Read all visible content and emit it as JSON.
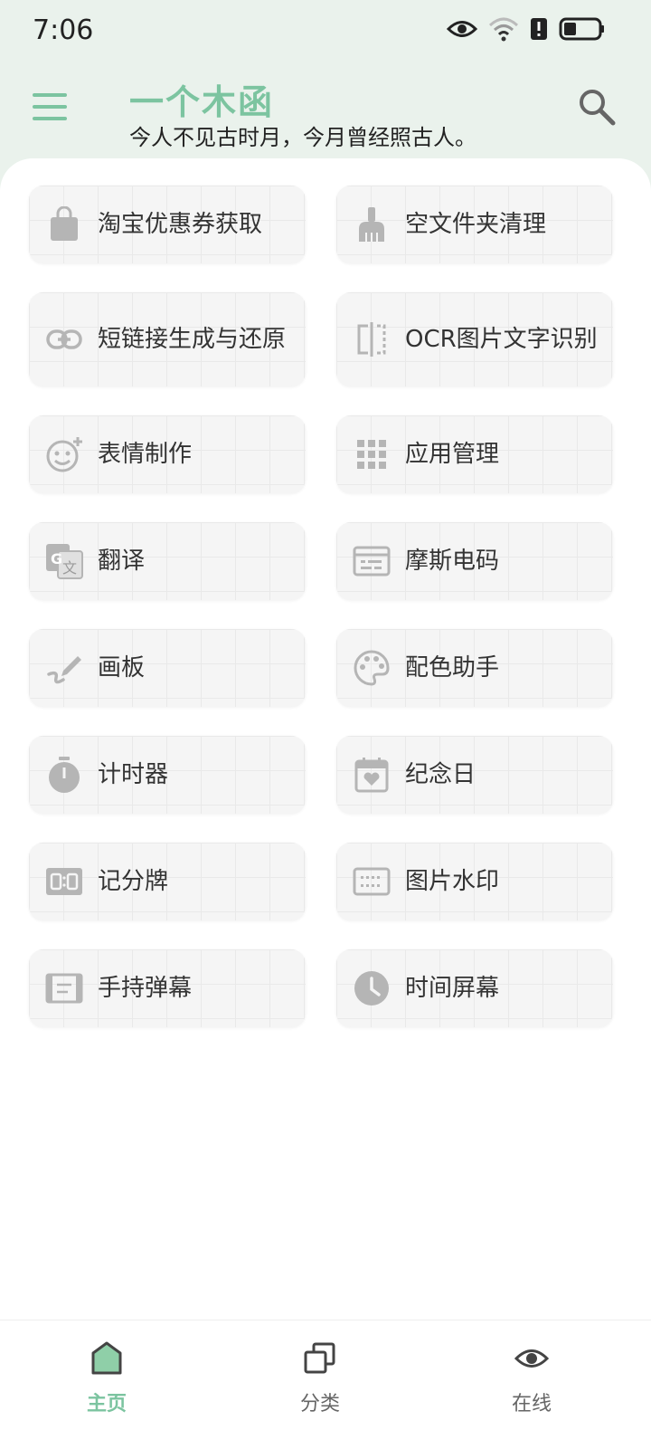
{
  "status_bar": {
    "time": "7:06",
    "icons": [
      "eye-icon",
      "wifi-icon",
      "alert-icon",
      "battery-icon"
    ]
  },
  "app_bar": {
    "title": "一个木函",
    "subtitle": "今人不见古时月，今月曾经照古人。",
    "accent_color": "#7cc4a0"
  },
  "tools": [
    {
      "label": "淘宝优惠券获取",
      "icon": "shopping-bag-icon"
    },
    {
      "label": "空文件夹清理",
      "icon": "broom-icon"
    },
    {
      "label": "短链接生成与还原",
      "icon": "link-icon"
    },
    {
      "label": "OCR图片文字识别",
      "icon": "ocr-scan-icon"
    },
    {
      "label": "表情制作",
      "icon": "emoji-add-icon"
    },
    {
      "label": "应用管理",
      "icon": "apps-grid-icon"
    },
    {
      "label": "翻译",
      "icon": "translate-icon"
    },
    {
      "label": "摩斯电码",
      "icon": "morse-card-icon"
    },
    {
      "label": "画板",
      "icon": "draw-icon"
    },
    {
      "label": "配色助手",
      "icon": "palette-icon"
    },
    {
      "label": "计时器",
      "icon": "stopwatch-icon"
    },
    {
      "label": "纪念日",
      "icon": "calendar-heart-icon"
    },
    {
      "label": "记分牌",
      "icon": "scoreboard-icon"
    },
    {
      "label": "图片水印",
      "icon": "watermark-icon"
    },
    {
      "label": "手持弹幕",
      "icon": "barrage-icon"
    },
    {
      "label": "时间屏幕",
      "icon": "clock-icon"
    }
  ],
  "bottom_nav": {
    "items": [
      {
        "label": "主页",
        "icon": "home-icon",
        "active": true
      },
      {
        "label": "分类",
        "icon": "category-icon",
        "active": false
      },
      {
        "label": "在线",
        "icon": "eye-icon",
        "active": false
      }
    ]
  }
}
